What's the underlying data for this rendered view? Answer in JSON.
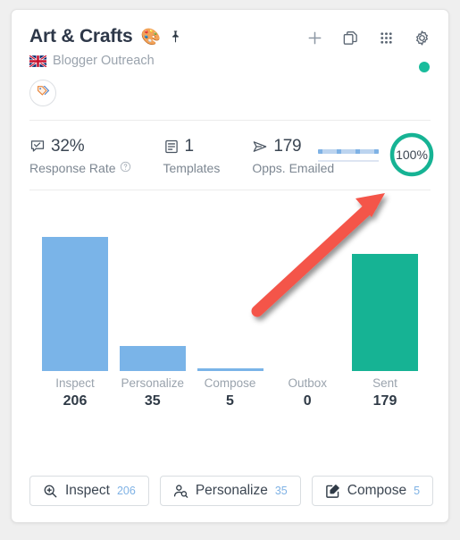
{
  "card": {
    "title": "Art & Crafts",
    "title_emoji": "🎨",
    "pin_icon": "pin-icon",
    "subtitle": "Blogger Outreach",
    "flag_icon": "uk-flag-icon",
    "status_color": "#1abc9c",
    "tag_icon": "tags-icon"
  },
  "header_actions": [
    {
      "name": "add-button",
      "icon": "plus-icon"
    },
    {
      "name": "duplicate-button",
      "icon": "copy-icon"
    },
    {
      "name": "apps-grid-button",
      "icon": "grid-icon"
    },
    {
      "name": "settings-button",
      "icon": "gear-icon"
    }
  ],
  "stats": [
    {
      "value": "32%",
      "label": "Response Rate",
      "icon": "comment-check-icon",
      "help_icon": "question-circle-icon",
      "has_help": true
    },
    {
      "value": "1",
      "label": "Templates",
      "icon": "template-icon",
      "has_help": false
    },
    {
      "value": "179",
      "label": "Opps. Emailed",
      "icon": "send-icon",
      "has_help": false
    }
  ],
  "progress": {
    "ring_value": "100%",
    "ring_color": "#16b394",
    "sparkline_color": "#7fb2e5"
  },
  "chart_data": {
    "type": "bar",
    "title": "",
    "xlabel": "",
    "ylabel": "",
    "categories": [
      "Inspect",
      "Personalize",
      "Compose",
      "Outbox",
      "Sent"
    ],
    "values": [
      206,
      35,
      5,
      0,
      179
    ],
    "value_labels": [
      "206",
      "35",
      "5",
      "0",
      "179"
    ],
    "colors": [
      "#7ab4e8",
      "#7ab4e8",
      "#7ab4e8",
      "#7ab4e8",
      "#16b394"
    ],
    "ylim": [
      0,
      206
    ],
    "grid": false,
    "legend": "none"
  },
  "footer_buttons": [
    {
      "label": "Inspect",
      "count": "206",
      "icon": "magnify-plus-icon"
    },
    {
      "label": "Personalize",
      "count": "35",
      "icon": "person-search-icon"
    },
    {
      "label": "Compose",
      "count": "5",
      "icon": "pencil-square-icon"
    }
  ],
  "annotation": {
    "arrow_color": "#f4544a",
    "arrow_target": "progress-ring"
  }
}
